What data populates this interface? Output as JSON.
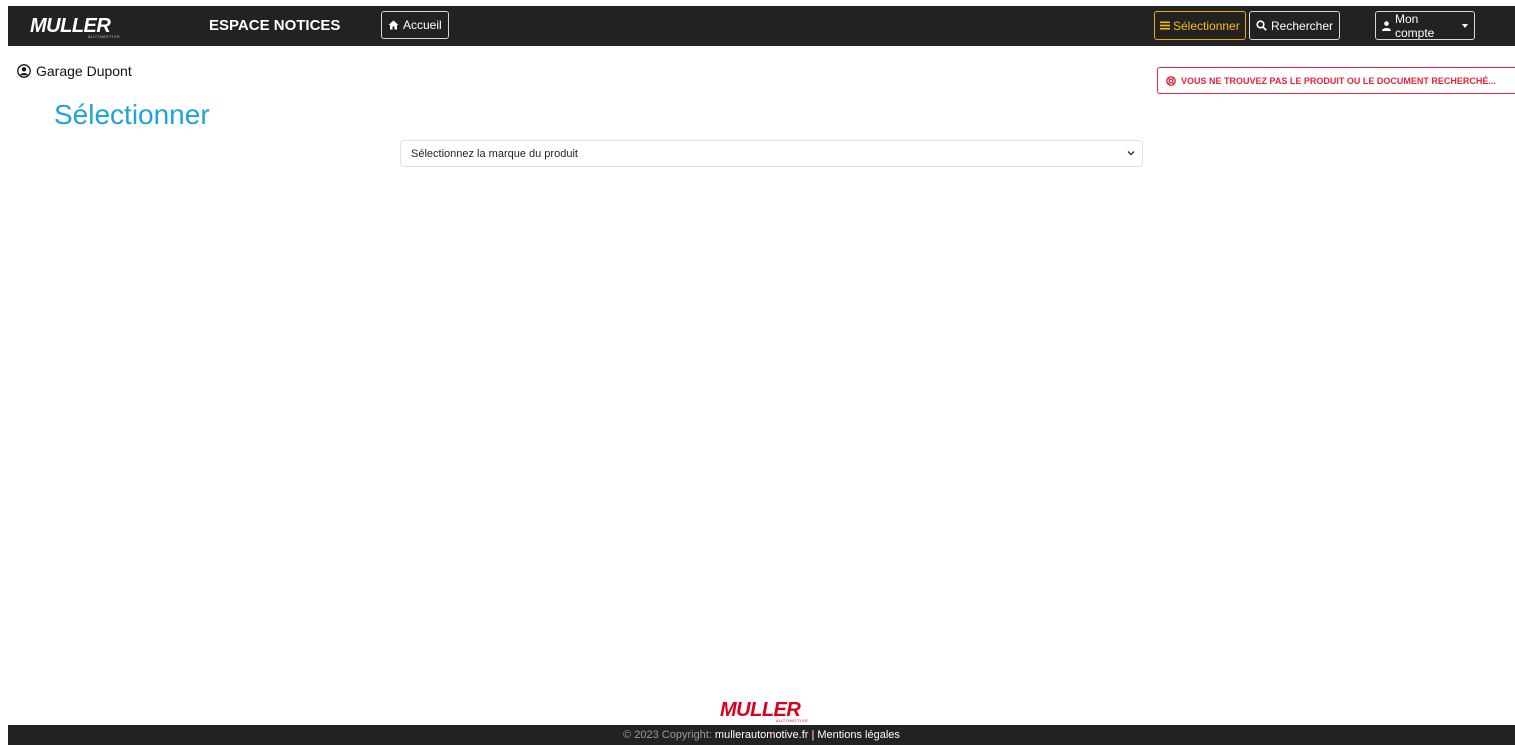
{
  "brand": {
    "logo_text": "MULLER",
    "logo_subtext": "AUTOMOTIVE",
    "title": "ESPACE NOTICES"
  },
  "nav": {
    "home_label": "Accueil",
    "select_label": "Sélectionner",
    "search_label": "Rechercher",
    "account_label": "Mon compte"
  },
  "user": {
    "name": "Garage Dupont"
  },
  "alert": {
    "text": "VOUS NE TROUVEZ PAS LE PRODUIT OU LE DOCUMENT RECHERCHÉ..."
  },
  "main": {
    "title": "Sélectionner",
    "brand_select_value": "Sélectionnez la marque du produit"
  },
  "footer": {
    "copyright": "© 2023 Copyright:",
    "site_link": "mullerautomotive.fr",
    "separator": "|",
    "legal_link": "Mentions légales"
  },
  "colors": {
    "navbar_bg": "#222222",
    "accent_yellow": "#f5c000",
    "alert_red": "#e8233a",
    "title_blue": "#1fa3d9",
    "logo_red": "#d9001b"
  },
  "icons": {
    "home": "home-icon",
    "menu": "bars-icon",
    "search": "search-icon",
    "user": "user-icon",
    "user_circle": "user-circle-icon",
    "lifebuoy": "lifebuoy-icon",
    "chevron": "chevron-down-icon"
  }
}
